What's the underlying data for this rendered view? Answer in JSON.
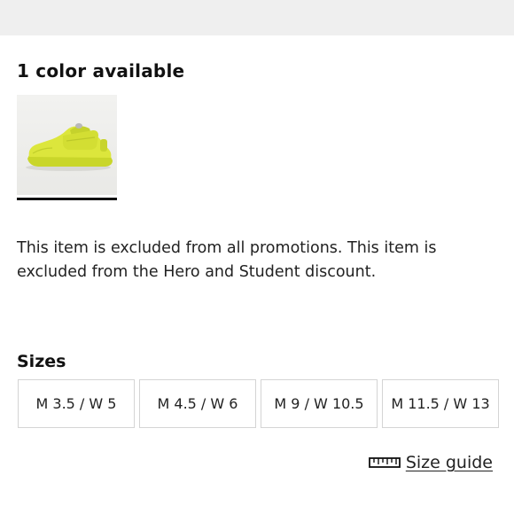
{
  "colors": {
    "heading": "1 color available",
    "swatches": [
      {
        "icon": "yellow-sneaker-image",
        "color": "#dce63c",
        "selected": true
      }
    ]
  },
  "notice": {
    "text": "This item is excluded from all promotions. This item is excluded from the Hero and Student discount."
  },
  "sizes": {
    "heading": "Sizes",
    "options": [
      {
        "label": "M 3.5 / W 5"
      },
      {
        "label": "M 4.5 / W 6"
      },
      {
        "label": "M 9 / W 10.5"
      },
      {
        "label": "M 11.5 / W 13"
      }
    ]
  },
  "size_guide": {
    "label": "Size guide",
    "icon": "ruler-icon"
  }
}
